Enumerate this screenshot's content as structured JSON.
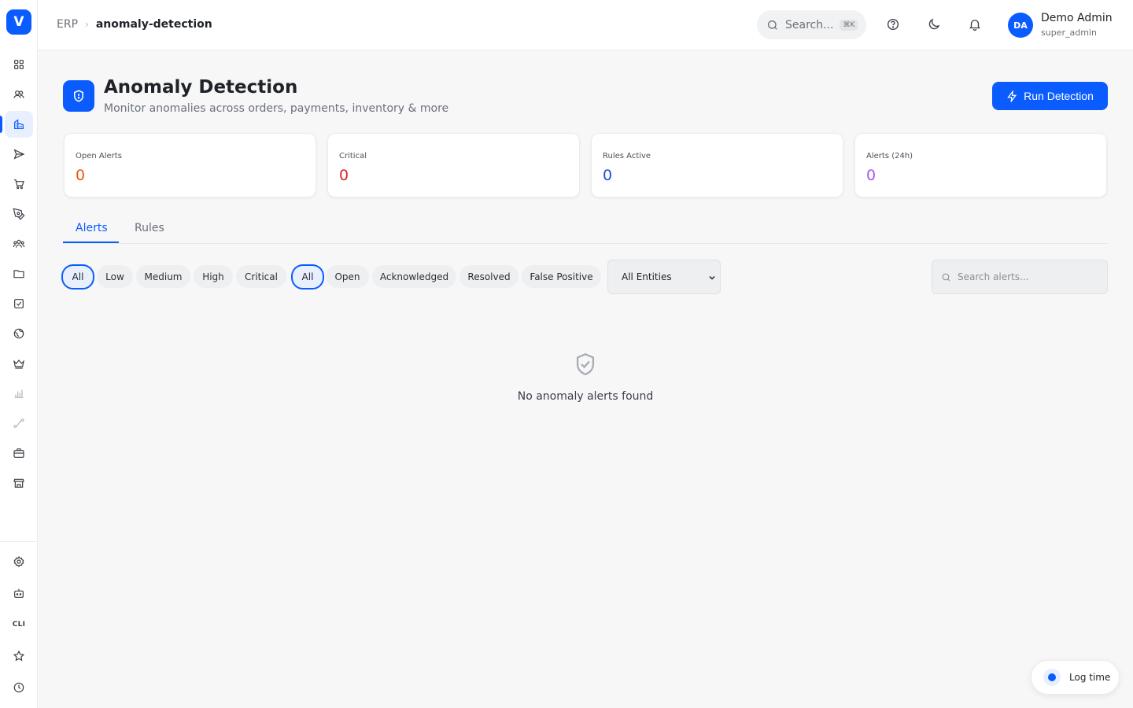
{
  "app": {
    "logo_letter": "V"
  },
  "breadcrumb": {
    "root": "ERP",
    "separator": "›",
    "current": "anomaly-detection"
  },
  "header": {
    "search_placeholder": "Search...",
    "search_shortcut": "⌘K",
    "user": {
      "initials": "DA",
      "name": "Demo Admin",
      "role": "super_admin"
    }
  },
  "sidebar": {
    "active_index": 2,
    "items": [
      {
        "icon": "dashboard-grid-icon"
      },
      {
        "icon": "users-icon"
      },
      {
        "icon": "building-icon"
      },
      {
        "icon": "send-icon"
      },
      {
        "icon": "cart-icon"
      },
      {
        "icon": "pen-tool-icon"
      },
      {
        "icon": "team-icon"
      },
      {
        "icon": "folder-icon"
      },
      {
        "icon": "checkbox-icon"
      },
      {
        "icon": "globe-icon"
      },
      {
        "icon": "crown-icon"
      },
      {
        "icon": "bar-chart-icon"
      },
      {
        "icon": "route-icon"
      },
      {
        "icon": "briefcase-icon"
      },
      {
        "icon": "store-icon"
      }
    ],
    "bottom_items": [
      {
        "icon": "settings-icon"
      },
      {
        "icon": "bot-icon"
      },
      {
        "icon": "cli-icon",
        "label": "CLI"
      },
      {
        "icon": "star-icon"
      },
      {
        "icon": "clock-icon"
      }
    ]
  },
  "page": {
    "title": "Anomaly Detection",
    "subtitle": "Monitor anomalies across orders, payments, inventory & more",
    "run_button": "Run Detection"
  },
  "stats": [
    {
      "label": "Open Alerts",
      "value": "0",
      "color": "#ea580c"
    },
    {
      "label": "Critical",
      "value": "0",
      "color": "#dc2626"
    },
    {
      "label": "Rules Active",
      "value": "0",
      "color": "#1d4ed8"
    },
    {
      "label": "Alerts (24h)",
      "value": "0",
      "color": "#a855f7"
    }
  ],
  "tabs": [
    {
      "label": "Alerts",
      "active": true
    },
    {
      "label": "Rules",
      "active": false
    }
  ],
  "filters": {
    "severity": [
      "All",
      "Low",
      "Medium",
      "High",
      "Critical"
    ],
    "severity_selected": "All",
    "status": [
      "All",
      "Open",
      "Acknowledged",
      "Resolved",
      "False Positive"
    ],
    "status_selected": "All",
    "entity_select": "All Entities",
    "search_placeholder": "Search alerts..."
  },
  "empty_state": {
    "icon": "shield-check-icon",
    "message": "No anomaly alerts found"
  },
  "log_time": {
    "label": "Log time"
  },
  "colors": {
    "accent": "#0b5cff"
  }
}
